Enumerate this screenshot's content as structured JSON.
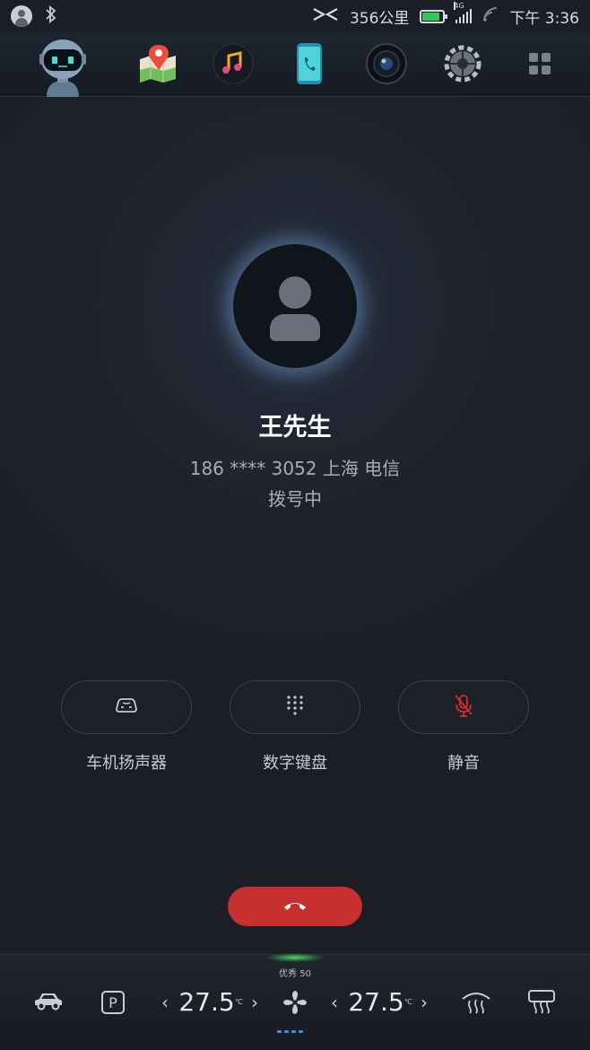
{
  "statusbar": {
    "range": "356公里",
    "network": "4G",
    "time": "下午 3:36",
    "battery_level": 0.85,
    "icons": [
      "user-icon",
      "bluetooth-icon",
      "xpeng-logo-icon",
      "battery-icon",
      "signal-icon",
      "wifi-icon"
    ]
  },
  "appbar": {
    "apps": [
      "assistant-robot",
      "maps",
      "music",
      "phone",
      "camera",
      "settings",
      "app-grid"
    ]
  },
  "call": {
    "contact_name": "王先生",
    "phone_info": "186 **** 3052  上海 电信",
    "status": "拨号中",
    "controls": [
      {
        "label": "车机扬声器",
        "icon": "car-speaker-icon"
      },
      {
        "label": "数字键盘",
        "icon": "keypad-icon"
      },
      {
        "label": "静音",
        "icon": "mute-mic-icon",
        "active_color": "#d0302f"
      }
    ],
    "hangup_icon": "hangup-icon",
    "hangup_color": "#c6302f"
  },
  "climate": {
    "air_quality": "优秀 50",
    "left_temp": "27.5",
    "right_temp": "27.5",
    "temp_unit": "℃",
    "left_arrow": "‹",
    "right_arrow": "›",
    "fan_level": 4
  },
  "colors": {
    "background": "#1b1e24",
    "accent_blue": "#3d8ef0",
    "danger_red": "#c6302f"
  }
}
